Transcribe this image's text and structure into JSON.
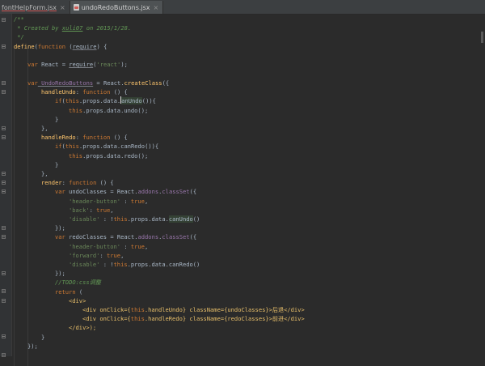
{
  "tabs": [
    {
      "label": "fontHelpForm.jsx",
      "close": "×"
    },
    {
      "label": "undoRedoButtons.jsx",
      "close": "×"
    }
  ],
  "code": {
    "line_1": "/**",
    "line_2_prefix": " * Created by ",
    "line_2_name": "xuli07",
    "line_2_suffix": " on 2015/1/28.",
    "line_3": " */",
    "line_4_kw": "define",
    "line_4_a": "(",
    "line_4_fn": "function",
    "line_4_b": " (",
    "line_4_req": "require",
    "line_4_c": ") {",
    "line_6_kw": "var",
    "line_6_a": " React = ",
    "line_6_req": "require",
    "line_6_b": "(",
    "line_6_str": "'react'",
    "line_6_c": ");",
    "line_8_kw": "var",
    "line_8_name": " UndoRedoButtons",
    "line_8_a": " = React.",
    "line_8_fn": "createClass",
    "line_8_b": "({",
    "line_9_name": "handleUndo",
    "line_9_a": ": ",
    "line_9_kw": "function",
    "line_9_b": " () {",
    "line_10_kw": "if",
    "line_10_a": "(",
    "line_10_this": "this",
    "line_10_b": ".props.data.",
    "line_10_c": "anUndo",
    "line_10_d": "()){",
    "line_11_this": "this",
    "line_11_a": ".props.data.undo();",
    "line_12": "}",
    "line_13": "},",
    "line_14_name": "handleRedo",
    "line_14_a": ": ",
    "line_14_kw": "function",
    "line_14_b": " () {",
    "line_15_kw": "if",
    "line_15_a": "(",
    "line_15_this": "this",
    "line_15_b": ".props.data.canRedo()){",
    "line_16_this": "this",
    "line_16_a": ".props.data.redo();",
    "line_17": "}",
    "line_18": "},",
    "line_19_name": "render",
    "line_19_a": ": ",
    "line_19_kw": "function",
    "line_19_b": " () {",
    "line_20_kw": "var",
    "line_20_a": " undoClasses = React.",
    "line_20_p": "addons",
    "line_20_b": ".",
    "line_20_fn": "classSet",
    "line_20_c": "({",
    "line_21_str": "'header-button'",
    "line_21_a": " : ",
    "line_21_kw": "true",
    "line_21_b": ",",
    "line_22_str": "'back'",
    "line_22_a": ": ",
    "line_22_kw": "true",
    "line_22_b": ",",
    "line_23_str": "'disable'",
    "line_23_a": " : !",
    "line_23_this": "this",
    "line_23_b": ".props.data.",
    "line_23_c": "canUndo",
    "line_23_d": "()",
    "line_24": "});",
    "line_25_kw": "var",
    "line_25_a": " redoClasses = React.",
    "line_25_p": "addons",
    "line_25_b": ".",
    "line_25_fn": "classSet",
    "line_25_c": "({",
    "line_26_str": "'header-button'",
    "line_26_a": " : ",
    "line_26_kw": "true",
    "line_26_b": ",",
    "line_27_str": "'forward'",
    "line_27_a": ": ",
    "line_27_kw": "true",
    "line_27_b": ",",
    "line_28_str": "'disable'",
    "line_28_a": " : !",
    "line_28_this": "this",
    "line_28_b": ".props.data.canRedo()",
    "line_29": "});",
    "line_30": "//TODO:css调整",
    "line_31_kw": "return",
    "line_31_a": " (",
    "line_32": "<div>",
    "line_33_a": "<div onClick={",
    "line_33_this": "this",
    "line_33_b": ".handleUndo} className={undoClasses}>后退</div>",
    "line_34_a": "<div onClick={",
    "line_34_this": "this",
    "line_34_b": ".handleRedo} className={redoClasses}>前进</div>",
    "line_35": "</div>);",
    "line_36": "}",
    "line_37": "});"
  },
  "colors": {
    "background": "#2b2b2b",
    "keyword": "#cc7832",
    "string": "#6a8759",
    "comment": "#629755",
    "function": "#ffc66d",
    "property": "#9876aa"
  }
}
